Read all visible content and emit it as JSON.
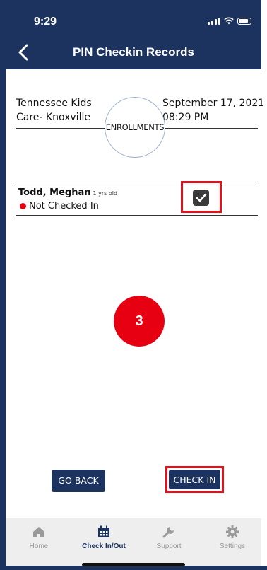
{
  "status": {
    "time": "9:29"
  },
  "nav": {
    "title": "PIN Checkin Records"
  },
  "header": {
    "center_line1": "Tennessee Kids",
    "center_line2": "Care- Knoxville",
    "enrollments_label": "ENROLLMENTS",
    "date": "September 17, 2021",
    "time": "08:29 PM"
  },
  "child": {
    "name": "Todd, Meghan",
    "age": "1 yrs old",
    "status": "Not Checked In",
    "checked": true
  },
  "step_badge": "3",
  "buttons": {
    "go_back": "GO BACK",
    "check_in": "CHECK IN"
  },
  "tabs": [
    {
      "label": "Home",
      "icon": "home-icon"
    },
    {
      "label": "Check In/Out",
      "icon": "calendar-icon",
      "active": true
    },
    {
      "label": "Support",
      "icon": "wrench-icon"
    },
    {
      "label": "Settings",
      "icon": "gear-icon"
    }
  ],
  "colors": {
    "primary": "#1c3360",
    "highlight": "#e3111c",
    "status_red": "#e60012"
  }
}
